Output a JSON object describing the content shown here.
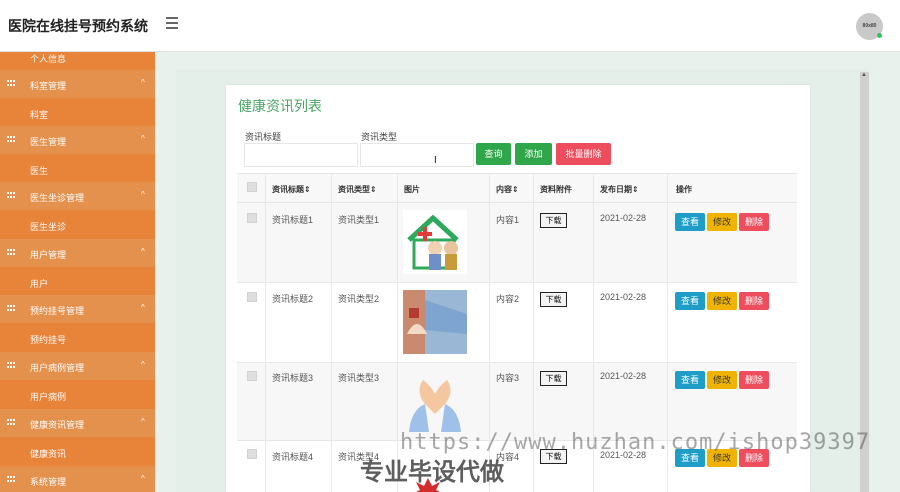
{
  "app": {
    "title": "医院在线挂号预约系统",
    "avatar_text": "80x80"
  },
  "sidebar": {
    "items": [
      {
        "type": "child",
        "label": "个人信息"
      },
      {
        "type": "parent",
        "label": "科室管理",
        "caret": "^"
      },
      {
        "type": "child",
        "label": "科室"
      },
      {
        "type": "parent",
        "label": "医生管理",
        "caret": "^"
      },
      {
        "type": "child",
        "label": "医生"
      },
      {
        "type": "parent",
        "label": "医生坐诊管理",
        "caret": "^"
      },
      {
        "type": "child",
        "label": "医生坐诊"
      },
      {
        "type": "parent",
        "label": "用户管理",
        "caret": "^"
      },
      {
        "type": "child",
        "label": "用户"
      },
      {
        "type": "parent",
        "label": "预约挂号管理",
        "caret": "^"
      },
      {
        "type": "child",
        "label": "预约挂号"
      },
      {
        "type": "parent",
        "label": "用户病例管理",
        "caret": "^"
      },
      {
        "type": "child",
        "label": "用户病例"
      },
      {
        "type": "parent",
        "label": "健康资讯管理",
        "caret": "^"
      },
      {
        "type": "child",
        "label": "健康资讯"
      },
      {
        "type": "parent",
        "label": "系统管理",
        "caret": "^"
      }
    ]
  },
  "page": {
    "title": "健康资讯列表"
  },
  "search": {
    "title_label": "资讯标题",
    "type_label": "资讯类型",
    "title_value": "",
    "type_value": "",
    "query_button": "查询",
    "add_button": "添加",
    "batch_delete_button": "批量删除"
  },
  "table": {
    "headers": {
      "title": "资讯标题⇕",
      "type": "资讯类型⇕",
      "image": "图片",
      "content": "内容⇕",
      "attachment": "资料附件",
      "date": "发布日期⇕",
      "actions": "操作"
    },
    "rows": [
      {
        "title": "资讯标题1",
        "type": "资讯类型1",
        "content": "内容1",
        "download": "下载",
        "date": "2021-02-28",
        "view": "查看",
        "edit": "修改",
        "delete": "删除"
      },
      {
        "title": "资讯标题2",
        "type": "资讯类型2",
        "content": "内容2",
        "download": "下载",
        "date": "2021-02-28",
        "view": "查看",
        "edit": "修改",
        "delete": "删除"
      },
      {
        "title": "资讯标题3",
        "type": "资讯类型3",
        "content": "内容3",
        "download": "下载",
        "date": "2021-02-28",
        "view": "查看",
        "edit": "修改",
        "delete": "删除"
      },
      {
        "title": "资讯标题4",
        "type": "资讯类型4",
        "content": "内容4",
        "download": "下载",
        "date": "2021-02-28",
        "view": "查看",
        "edit": "修改",
        "delete": "删除"
      }
    ]
  },
  "watermark": {
    "url": "https://www.huzhan.com/ishop39397",
    "text": "专业毕设代做"
  },
  "colors": {
    "sidebar": "#e8833a",
    "sidebar_parent": "#e4914d",
    "title_green": "#4aa463",
    "btn_green": "#2fa64a",
    "btn_red": "#ee4d5e",
    "btn_view": "#1e9ec7",
    "btn_edit": "#f0b400"
  }
}
